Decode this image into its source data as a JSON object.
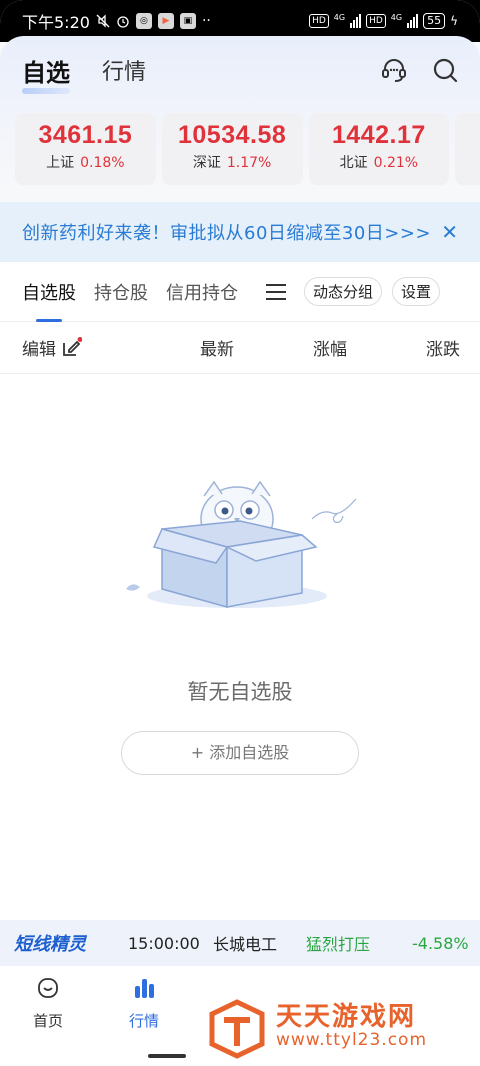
{
  "status_bar": {
    "time": "下午5:20",
    "net_tag_1": "HD",
    "net_gen_1": "4G",
    "net_tag_2": "HD",
    "net_gen_2": "4G",
    "battery": "55"
  },
  "header": {
    "tabs": [
      {
        "label": "自选",
        "active": true
      },
      {
        "label": "行情",
        "active": false
      }
    ],
    "icons": [
      "headset-icon",
      "search-icon"
    ]
  },
  "indices": [
    {
      "value": "3461.15",
      "name": "上证",
      "change": "0.18%"
    },
    {
      "value": "10534.58",
      "name": "深证",
      "change": "1.17%"
    },
    {
      "value": "1442.17",
      "name": "北证",
      "change": "0.21%"
    }
  ],
  "banner": {
    "text": "创新药利好来袭！审批拟从60日缩减至30日>>>",
    "close_glyph": "✕"
  },
  "subtabs": {
    "items": [
      {
        "label": "自选股",
        "active": true
      },
      {
        "label": "持仓股",
        "active": false
      },
      {
        "label": "信用持仓",
        "active": false
      }
    ],
    "group_button": "动态分组",
    "settings_button": "设置"
  },
  "columns": {
    "edit_label": "编辑",
    "latest": "最新",
    "change_pct": "涨幅",
    "change_amt": "涨跌"
  },
  "empty_state": {
    "message": "暂无自选股",
    "add_button": "+ 添加自选股"
  },
  "ticker": {
    "brand": "短线精灵",
    "time": "15:00:00",
    "stock": "长城电工",
    "signal": "猛烈打压",
    "change": "-4.58%"
  },
  "bottom_nav": {
    "items": [
      {
        "label": "首页",
        "icon": "home-icon",
        "active": false
      },
      {
        "label": "行情",
        "icon": "chart-bars-icon",
        "active": true
      }
    ]
  },
  "watermark": {
    "title": "天天游戏网",
    "url": "www.ttyl23.com"
  },
  "colors": {
    "accent": "#2f6ee0",
    "up_red": "#e0323a",
    "down_green": "#2aa641",
    "banner_blue": "#2a7bd4"
  }
}
